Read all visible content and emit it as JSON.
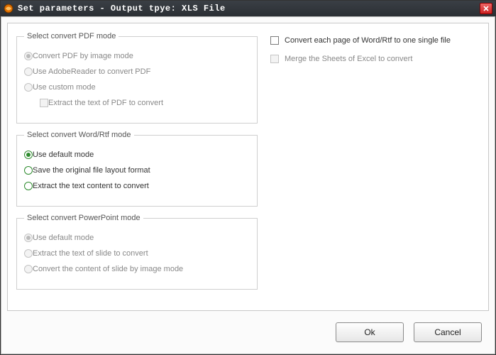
{
  "window": {
    "title": "Set parameters - Output tpye: XLS File"
  },
  "groups": {
    "pdf": {
      "legend": "Select convert PDF mode",
      "opt1": "Convert PDF by image mode",
      "opt2": "Use AdobeReader to convert PDF",
      "opt3": "Use custom mode",
      "sub1": "Extract the text of PDF to convert"
    },
    "word": {
      "legend": "Select convert Word/Rtf mode",
      "opt1": "Use default mode",
      "opt2": "Save the original file layout format",
      "opt3": "Extract the text content to convert",
      "selected": "opt1"
    },
    "ppt": {
      "legend": "Select convert PowerPoint mode",
      "opt1": "Use default mode",
      "opt2": "Extract the text of slide to convert",
      "opt3": "Convert the content of slide by image mode"
    }
  },
  "right": {
    "chk1": "Convert each page of Word/Rtf to one single file",
    "chk2": "Merge the Sheets of Excel to convert"
  },
  "buttons": {
    "ok": "Ok",
    "cancel": "Cancel"
  }
}
